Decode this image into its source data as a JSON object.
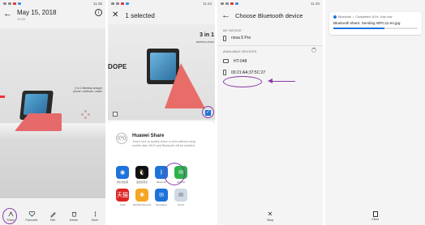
{
  "panel1": {
    "status_time": "11:36",
    "title": "May 15, 2018",
    "subtitle": "10:59",
    "product_caption": "3 in 1 Wireless charger",
    "product_caption_2": "phone • earbuds • watch",
    "toolbar": [
      {
        "label": "Share",
        "icon": "share-icon"
      },
      {
        "label": "Favourite",
        "icon": "heart-icon"
      },
      {
        "label": "Edit",
        "icon": "edit-icon"
      },
      {
        "label": "Delete",
        "icon": "trash-icon"
      },
      {
        "label": "More",
        "icon": "more-icon"
      }
    ]
  },
  "panel2": {
    "status_time": "11:44",
    "title": "1 selected",
    "photo_heading": "3 in 1",
    "photo_sub": "wireless chars",
    "photo_word": "DOPE",
    "huawei_share_title": "Huawei Share",
    "huawei_share_desc": "Touch here to quickly share or print without using mobile data. Wi-Fi and Bluetooth will be enabled.",
    "apps": [
      {
        "label": "微信朋友圈",
        "color": "#1e73d9",
        "glyph": "◉"
      },
      {
        "label": "发送给朋友",
        "color": "#111111",
        "glyph": "🐧"
      },
      {
        "label": "Bluetooth",
        "color": "#1e73d9",
        "glyph": "ᛒ"
      },
      {
        "label": "WeChat",
        "color": "#2bb24c",
        "glyph": "✉"
      },
      {
        "label": "",
        "color": "#ffffff",
        "glyph": ""
      },
      {
        "label": "Tmall",
        "color": "#e02424",
        "glyph": "天猫"
      },
      {
        "label": "WeChat Moments",
        "color": "#f5a623",
        "glyph": "✺"
      },
      {
        "label": "Messaging",
        "color": "#1e73d9",
        "glyph": "✉"
      },
      {
        "label": "Email",
        "color": "#cfd8e3",
        "glyph": "✉"
      },
      {
        "label": "",
        "color": "#ffffff",
        "glyph": ""
      }
    ]
  },
  "panel3": {
    "status_time": "11:45",
    "title": "Choose Bluetooth device",
    "my_device_label": "MY DEVICE",
    "my_device_name": "nova 5 Pro",
    "available_label": "AVAILABLE DEVICES",
    "devices": [
      "HT-048",
      "00:21:AA:37:5C:27"
    ],
    "footer_label": "Stop"
  },
  "panel4": {
    "notif_source": "Bluetooth",
    "notif_status": "Completed: 61%",
    "notif_time": "Just now",
    "notif_text": "Bluetooth share: Sending WPC11-en.jpg",
    "progress_fraction": 0.61,
    "footer_label": "Clear"
  },
  "colors": {
    "accent": "#1e73d9",
    "highlight": "#8a3aa8",
    "stand": "#e86c68"
  }
}
